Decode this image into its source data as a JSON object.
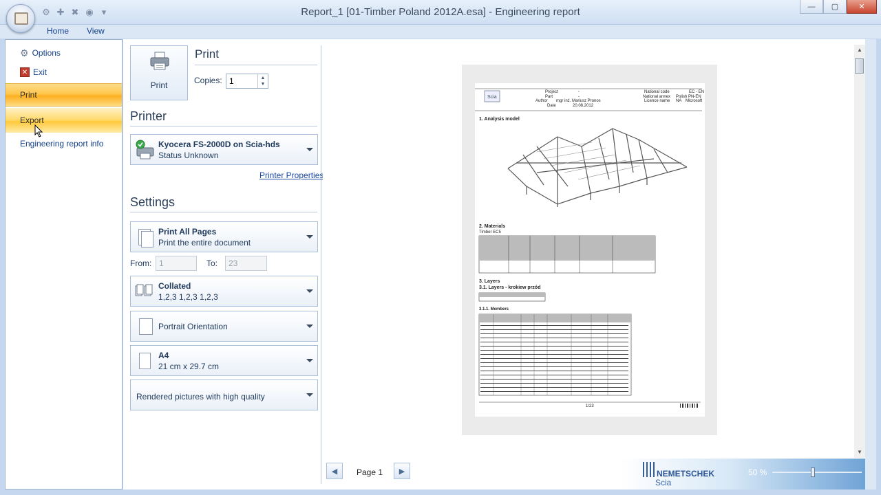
{
  "window": {
    "title": "Report_1 [01-Timber Poland 2012A.esa] - Engineering report",
    "min_glyph": "—",
    "max_glyph": "▢",
    "close_glyph": "✕"
  },
  "qat_icons": [
    "gear-icon",
    "plus-icon",
    "delete-icon",
    "refresh-icon",
    "dropdown-icon"
  ],
  "ribbon_tabs": [
    "Home",
    "View"
  ],
  "leftnav": {
    "options": "Options",
    "exit": "Exit",
    "print": "Print",
    "export": "Export",
    "info": "Engineering report info"
  },
  "print_section": {
    "button_label": "Print",
    "title": "Print",
    "copies_label": "Copies:",
    "copies_value": "1"
  },
  "printer_section": {
    "title": "Printer",
    "printer_name": "Kyocera FS-2000D on Scia-hds",
    "printer_status": "Status Unknown",
    "properties_link": "Printer Properties"
  },
  "settings_section": {
    "title": "Settings",
    "pages_title": "Print All Pages",
    "pages_sub": "Print the entire document",
    "from_label": "From:",
    "from_value": "1",
    "to_label": "To:",
    "to_value": "23",
    "collated_title": "Collated",
    "collated_sub": "1,2,3  1,2,3  1,2,3",
    "orientation": "Portrait Orientation",
    "paper_title": "A4",
    "paper_sub": "21 cm x 29.7 cm",
    "quality": "Rendered pictures with high quality"
  },
  "preview_page": {
    "header_left": [
      "Project",
      "Part",
      "Author",
      "Date"
    ],
    "header_vals": [
      "-",
      "-",
      "mgr inż. Mariusz Pronos",
      "20.08.2012"
    ],
    "header_right": [
      "National code",
      "National annex",
      "Licence name"
    ],
    "header_right_vals": [
      "EC - EN",
      "Polish PN-EN NA",
      "Microsoft"
    ],
    "h1": "1. Analysis model",
    "h2": "2. Materials",
    "h2_sub": "Timber EC5",
    "h3": "3. Layers",
    "h31": "3.1. Layers - krokiew  przód",
    "h311": "3.1.1. Members",
    "footer": "1/23"
  },
  "bottom": {
    "page_label": "Page 1",
    "prev_glyph": "◀",
    "next_glyph": "▶",
    "logo_text": "NEMETSCHEK",
    "logo_sub": "Scia",
    "zoom": "50 %",
    "zoom_fraction": 0.45
  }
}
